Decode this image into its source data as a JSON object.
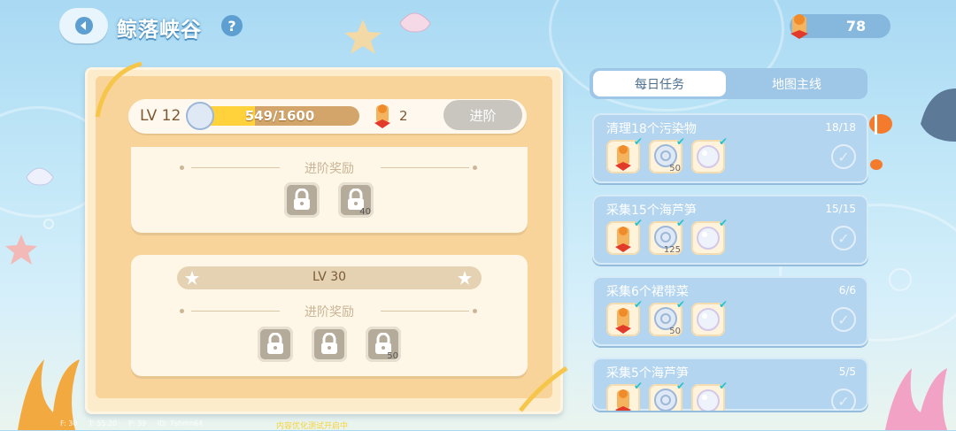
{
  "header": {
    "title": "鲸落峡谷",
    "help": "?",
    "currency_value": "78"
  },
  "level": {
    "label": "LV 12",
    "progress_text": "549/1600",
    "progress_fraction": 0.343,
    "scroll_count": "2",
    "advance_label": "进阶"
  },
  "rewards_section_1": {
    "title": "进阶奖励",
    "slots": [
      {
        "count": ""
      },
      {
        "count": "40"
      }
    ]
  },
  "rewards_section_2": {
    "level_label": "LV 30",
    "title": "进阶奖励",
    "slots": [
      {
        "count": ""
      },
      {
        "count": ""
      },
      {
        "count": "50"
      }
    ]
  },
  "tabs": [
    {
      "label": "每日任务",
      "active": true
    },
    {
      "label": "地图主线",
      "active": false
    }
  ],
  "tasks": [
    {
      "name": "清理18个污染物",
      "progress": "18/18",
      "rewards": [
        {
          "icon": "scroll-icon",
          "count": ""
        },
        {
          "icon": "shell-icon",
          "count": "50"
        },
        {
          "icon": "pearl-icon",
          "count": ""
        }
      ]
    },
    {
      "name": "采集15个海芦笋",
      "progress": "15/15",
      "rewards": [
        {
          "icon": "scroll-icon",
          "count": ""
        },
        {
          "icon": "shell-icon",
          "count": "125"
        },
        {
          "icon": "pearl-icon",
          "count": ""
        }
      ]
    },
    {
      "name": "采集6个裙带菜",
      "progress": "6/6",
      "rewards": [
        {
          "icon": "scroll-icon",
          "count": ""
        },
        {
          "icon": "shell-icon",
          "count": "50"
        },
        {
          "icon": "pearl-icon",
          "count": ""
        }
      ]
    },
    {
      "name": "采集5个海芦笋",
      "progress": "5/5",
      "rewards": [
        {
          "icon": "scroll-icon",
          "count": ""
        },
        {
          "icon": "shell-icon",
          "count": ""
        },
        {
          "icon": "pearl-icon",
          "count": ""
        }
      ]
    }
  ],
  "footer": {
    "fps": "F: 30",
    "time": "T: 55.20",
    "ping": "P: 39",
    "id": "ID: 7shmn64",
    "note": "内容优化测试开启中"
  },
  "colors": {
    "accent_blue": "#5d9fd0",
    "progress_yellow": "#ffd23c",
    "parchment": "#f8d49a"
  }
}
